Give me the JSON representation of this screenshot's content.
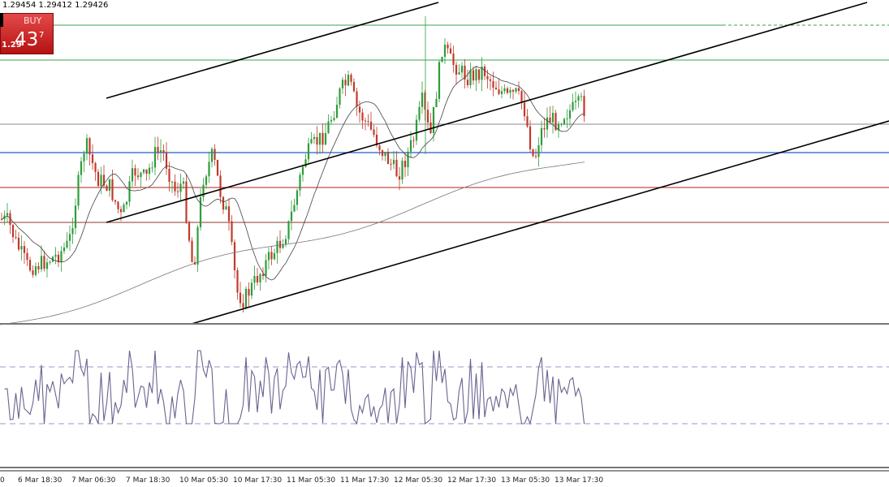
{
  "header": {
    "ohlc_text": "1.29454 1.29412 1.29426"
  },
  "trade": {
    "side_label": "BUY",
    "price_prefix": "1.29",
    "price_big": "43",
    "price_small": "7"
  },
  "time_axis": {
    "labels": [
      "0",
      "6 Mar 18:30",
      "7 Mar 06:30",
      "7 Mar 18:30",
      "10 Mar 05:30",
      "10 Mar 17:30",
      "11 Mar 05:30",
      "11 Mar 17:30",
      "12 Mar 05:30",
      "12 Mar 17:30",
      "13 Mar 05:30",
      "13 Mar 17:30"
    ]
  },
  "colors": {
    "background": "#ffffff",
    "bull_candle": "#2e9c3a",
    "bear_candle": "#c0392b",
    "green_level": "#3aa64a",
    "blue_level": "#1f5fc6",
    "red_level": "#b22222",
    "channel": "#000000",
    "oscillator": "#6a6390"
  }
}
